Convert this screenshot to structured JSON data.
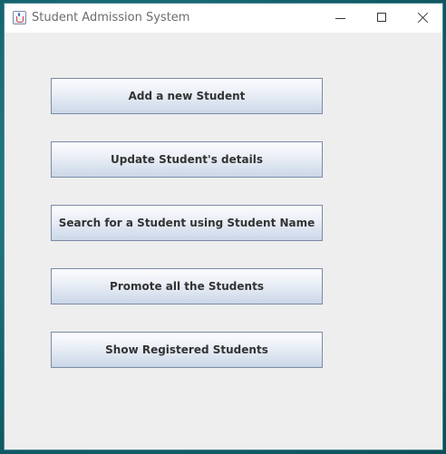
{
  "window": {
    "title": "Student Admission System",
    "icon": "java-app-icon"
  },
  "title_controls": {
    "minimize_icon": "minimize-icon",
    "maximize_icon": "maximize-icon",
    "close_icon": "close-icon"
  },
  "buttons": [
    {
      "label": "Add a new Student"
    },
    {
      "label": "Update Student's details"
    },
    {
      "label": "Search for a Student using Student Name"
    },
    {
      "label": "Promote all the Students"
    },
    {
      "label": "Show Registered Students"
    }
  ],
  "colors": {
    "window_bg": "#eeeeee",
    "button_border": "#7a8aa6",
    "button_text": "#333333",
    "title_text": "#6c6c6c"
  }
}
